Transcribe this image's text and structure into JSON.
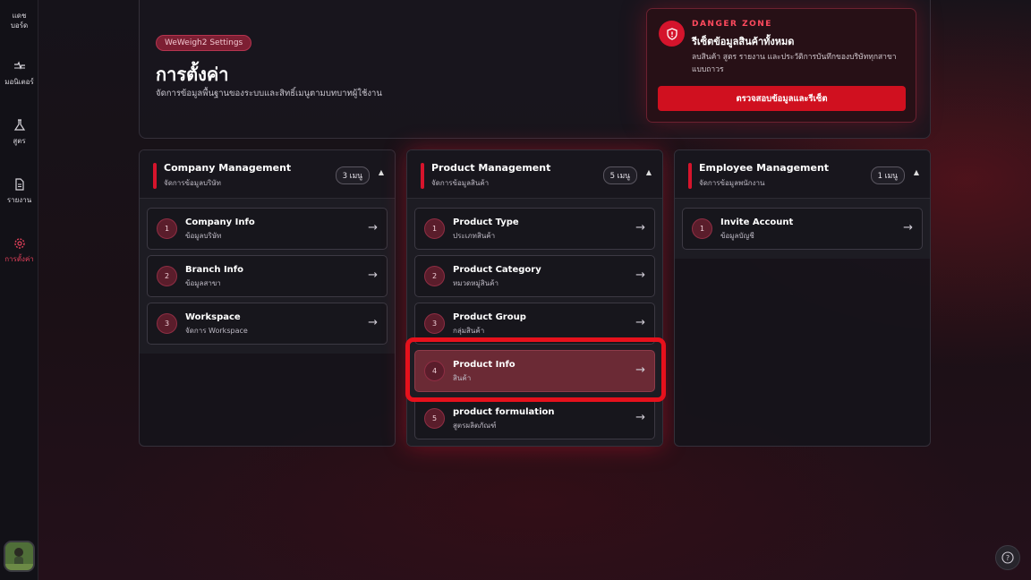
{
  "sidebar": {
    "items": [
      {
        "label": "แดช\nบอร์ด",
        "icon": "dashboard-icon"
      },
      {
        "label": "มอนิเตอร์",
        "icon": "monitor-icon"
      },
      {
        "label": "สูตร",
        "icon": "flask-icon"
      },
      {
        "label": "รายงาน",
        "icon": "report-icon"
      },
      {
        "label": "การตั้งค่า",
        "icon": "settings-icon",
        "active": true
      }
    ]
  },
  "header": {
    "badge": "WeWeigh2 Settings",
    "title": "การตั้งค่า",
    "subtitle": "จัดการข้อมูลพื้นฐานของระบบและสิทธิ์เมนูตามบทบาทผู้ใช้งาน"
  },
  "danger_zone": {
    "label": "DANGER ZONE",
    "title": "รีเซ็ตข้อมูลสินค้าทั้งหมด",
    "description": "ลบสินค้า สูตร รายงาน และประวัติการบันทึกของบริษัททุกสาขาแบบถาวร",
    "button": "ตรวจสอบข้อมูลและรีเซ็ต"
  },
  "columns": [
    {
      "title": "Company Management",
      "subtitle": "จัดการข้อมูลบริษัท",
      "count": "3 เมนู",
      "items": [
        {
          "num": "1",
          "title": "Company Info",
          "subtitle": "ข้อมูลบริษัท"
        },
        {
          "num": "2",
          "title": "Branch Info",
          "subtitle": "ข้อมูลสาขา"
        },
        {
          "num": "3",
          "title": "Workspace",
          "subtitle": "จัดการ Workspace"
        }
      ]
    },
    {
      "title": "Product Management",
      "subtitle": "จัดการข้อมูลสินค้า",
      "count": "5 เมนู",
      "items": [
        {
          "num": "1",
          "title": "Product Type",
          "subtitle": "ประเภทสินค้า"
        },
        {
          "num": "2",
          "title": "Product Category",
          "subtitle": "หมวดหมู่สินค้า"
        },
        {
          "num": "3",
          "title": "Product Group",
          "subtitle": "กลุ่มสินค้า"
        },
        {
          "num": "4",
          "title": "Product Info",
          "subtitle": "สินค้า"
        },
        {
          "num": "5",
          "title": "product formulation",
          "subtitle": "สูตรผลิตภัณฑ์"
        }
      ]
    },
    {
      "title": "Employee Management",
      "subtitle": "จัดการข้อมูลพนักงาน",
      "count": "1 เมนู",
      "items": [
        {
          "num": "1",
          "title": "Invite Account",
          "subtitle": "ข้อมูลบัญชี"
        }
      ]
    }
  ],
  "arrow_glyph": "→",
  "caret_glyph": "▲",
  "help_glyph": "?"
}
